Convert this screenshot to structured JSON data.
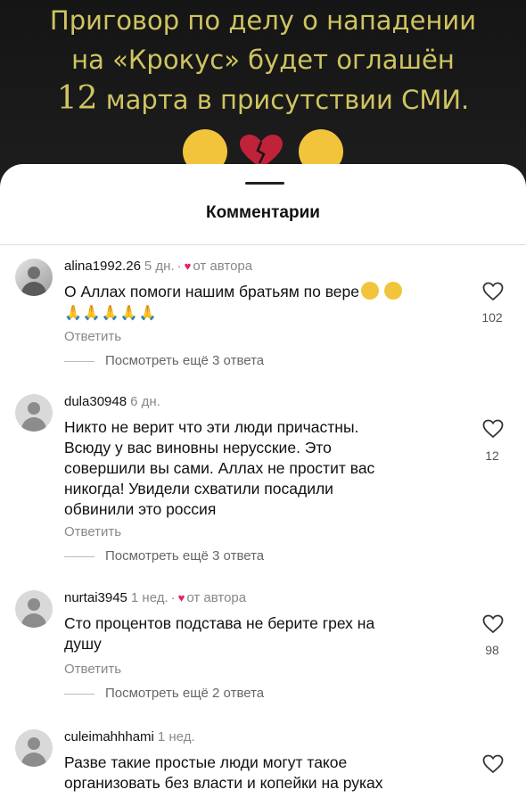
{
  "video": {
    "headline": {
      "line1": "Приговор по делу о нападении",
      "line2": "на «Крокус» будет оглашён",
      "line3_number": "12",
      "line3_rest": " марта в присутствии СМИ."
    }
  },
  "sheet": {
    "title": "Комментарии"
  },
  "labels": {
    "reply": "Ответить",
    "by_author": "от автора",
    "separator": "·",
    "heart": "♥"
  },
  "comments": [
    {
      "username": "alina1992.26",
      "time": "5 дн.",
      "author_liked": true,
      "text_line1": "О Аллах помоги нашим братьям по вере",
      "text_line2_emoji": "🙏🙏🙏🙏🙏",
      "likes": "102",
      "view_replies": "Посмотреть ещё 3 ответа"
    },
    {
      "username": "dula30948",
      "time": "6 дн.",
      "author_liked": false,
      "lines": [
        "Никто не верит что эти люди причастны.",
        "Всюду у вас виновны нерусские. Это",
        "совершили вы сами.  Аллах не простит вас",
        "никогда! Увидели схватили посадили",
        "обвинили это россия"
      ],
      "likes": "12",
      "view_replies": "Посмотреть ещё 3 ответа"
    },
    {
      "username": "nurtai3945",
      "time": "1 нед.",
      "author_liked": true,
      "lines": [
        "Сто процентов подстава не берите грех на",
        "душу"
      ],
      "likes": "98",
      "view_replies": "Посмотреть ещё 2 ответа"
    },
    {
      "username": "culeimahhhami",
      "time": "1 нед.",
      "author_liked": false,
      "lines": [
        "Разве такие простые люди могут такое",
        "организовать без власти и копейки на руках"
      ]
    }
  ],
  "colors": {
    "headline": "#cfc460",
    "author_heart": "#e0245e",
    "emoji": "#f2c43c"
  },
  "icons": [
    "heart-outline-icon",
    "broken-heart-icon",
    "pleading-face-icon",
    "default-avatar-icon",
    "folded-hands-icon"
  ]
}
